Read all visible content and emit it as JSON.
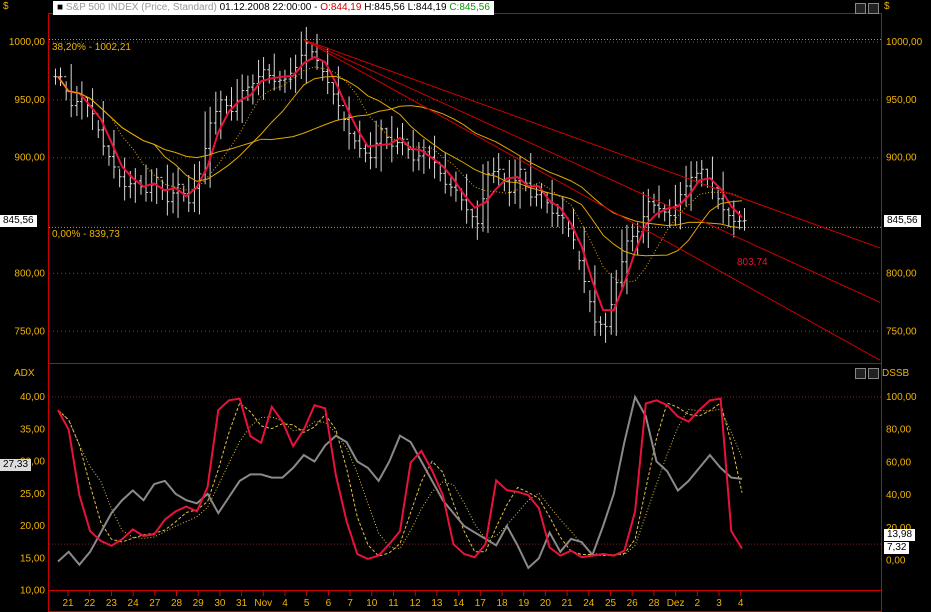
{
  "header": {
    "currency_left": "$",
    "currency_right": "$",
    "symbol": "S&P 500 INDEX (Price, Standard)",
    "datetime": "01.12.2008 22:00:00",
    "open": "O:844,19",
    "high": "H:845,56",
    "low": "L:844,19",
    "close": "C:845,56"
  },
  "price_panel": {
    "y_ticks": [
      "1000,00",
      "950,00",
      "900,00",
      "800,00",
      "750,00"
    ],
    "last_price_tag": "845,56",
    "fib_top_label": "38,20% - 1002,21",
    "fib_bottom_label": "0,00% - 839,73",
    "trend_label": "803,74"
  },
  "indicator_panel": {
    "left_title": "ADX",
    "right_title": "DSSB",
    "left_ticks": [
      "40,00",
      "35,00",
      "30,00",
      "25,00",
      "20,00",
      "15,00",
      "10,00"
    ],
    "right_ticks": [
      "100,00",
      "80,00",
      "60,00",
      "40,00",
      "20,00",
      "0,00"
    ],
    "adx_tag": "27,33",
    "dss_tag_1": "13,98",
    "dss_tag_2": "7,32"
  },
  "date_axis": [
    "21",
    "22",
    "23",
    "24",
    "27",
    "28",
    "29",
    "30",
    "31",
    "Nov",
    "4",
    "5",
    "6",
    "7",
    "10",
    "11",
    "12",
    "13",
    "14",
    "17",
    "18",
    "19",
    "20",
    "21",
    "24",
    "25",
    "26",
    "28",
    "Dez",
    "2",
    "3",
    "4"
  ],
  "colors": {
    "price_bars": "#d8d8d8",
    "ma_red": "#e8123c",
    "ma_gold": "#e0a800",
    "trend_red": "#d00000",
    "adx_gray": "#8a8a8a",
    "dss_red": "#e8123c",
    "axis_text": "#f0b400",
    "panel_border": "#d00000"
  },
  "chart_data": {
    "type": "line",
    "price": {
      "series_close": [
        970,
        945,
        952,
        938,
        910,
        892,
        875,
        880,
        870,
        883,
        862,
        877,
        861,
        886,
        930,
        950,
        940,
        958,
        964,
        976,
        966,
        968,
        978,
        999,
        984,
        965,
        945,
        921,
        908,
        900,
        925,
        910,
        916,
        898,
        905,
        896,
        877,
        872,
        855,
        843,
        886,
        890,
        870,
        890,
        866,
        870,
        852,
        848,
        829,
        793,
        758,
        754,
        792,
        828,
        836,
        862,
        856,
        850,
        868,
        883,
        890,
        874,
        855,
        845,
        845.56
      ],
      "ylim": [
        720,
        1030
      ]
    },
    "adx": {
      "values": [
        14.5,
        16,
        14,
        16,
        19,
        22,
        24,
        25.5,
        24,
        26.5,
        27,
        25,
        24,
        23.5,
        25,
        22,
        24.5,
        27,
        28,
        28,
        27.5,
        27.5,
        29,
        31,
        30,
        32.5,
        34,
        33,
        30,
        29,
        27,
        30,
        34,
        33,
        30,
        27,
        24,
        22,
        20,
        19,
        18,
        17,
        20,
        17,
        13.5,
        15,
        19,
        16,
        18,
        17.5,
        15.5,
        20,
        25,
        33,
        40,
        37,
        30,
        28.5,
        25.5,
        27,
        29,
        31,
        29,
        27.5,
        27.3
      ],
      "ylim": [
        8,
        42
      ]
    },
    "dss": {
      "values": [
        92,
        80,
        40,
        18,
        12,
        9,
        13,
        19,
        15,
        16,
        25,
        30,
        33,
        30,
        45,
        92,
        98,
        99,
        76,
        72,
        94,
        85,
        70,
        80,
        95,
        93,
        52,
        24,
        4,
        1,
        3,
        10,
        18,
        60,
        67,
        55,
        40,
        10,
        4,
        2,
        10,
        49,
        43,
        42,
        40,
        32,
        8,
        3,
        6,
        2,
        3,
        4,
        3,
        6,
        30,
        96,
        98,
        95,
        88,
        85,
        92,
        98,
        99,
        18,
        7.32
      ],
      "ylim": [
        -3,
        100
      ]
    }
  }
}
